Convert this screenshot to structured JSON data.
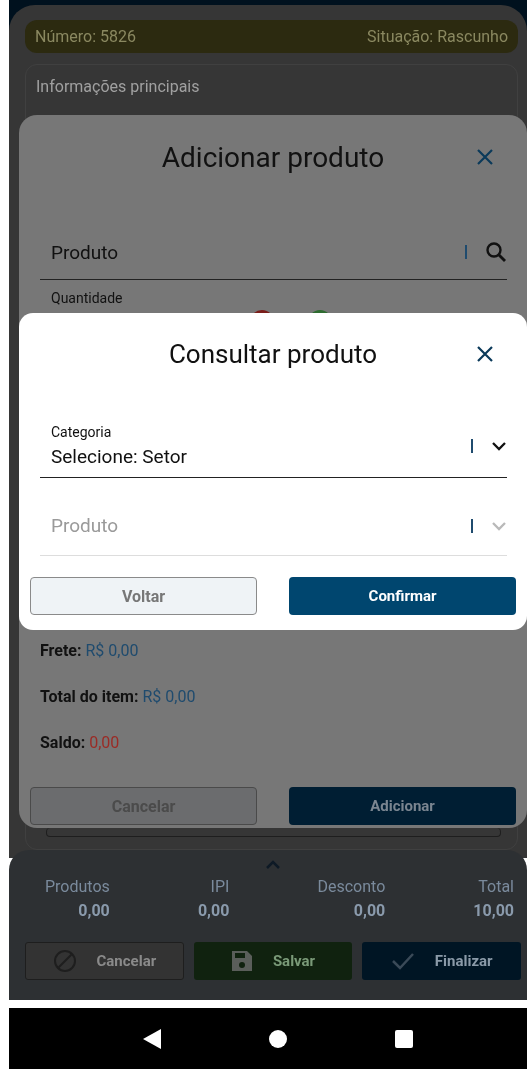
{
  "header": {
    "number": "Número: 5826",
    "status": "Situação: Rascunho"
  },
  "card": {
    "title": "Informações principais"
  },
  "add_dialog": {
    "title": "Adicionar produto",
    "product_field": {
      "placeholder": "Produto"
    },
    "quantity_label": "Quantidade",
    "lines": [
      {
        "label": "Frete:",
        "value": "R$ 0,00",
        "color": "#1f4b6e"
      },
      {
        "label": "Total do item:",
        "value": "R$ 0,00",
        "color": "#1f4b6e"
      },
      {
        "label": "Saldo:",
        "value": "0,00",
        "color": "#9b2b25"
      }
    ],
    "buttons": [
      {
        "label": "Cancelar",
        "kind": "secondary"
      },
      {
        "label": "Adicionar",
        "kind": "primary"
      }
    ]
  },
  "search_dialog": {
    "title": "Consultar produto",
    "fields": [
      {
        "label": "Categoria",
        "value": "Selecione: Setor",
        "disabled": false
      },
      {
        "placeholder": "Produto",
        "disabled": true
      }
    ],
    "buttons": [
      {
        "label": "Voltar",
        "kind": "secondary"
      },
      {
        "label": "Confirmar",
        "kind": "primary"
      }
    ]
  },
  "totals": [
    {
      "label": "Produtos",
      "value": "0,00"
    },
    {
      "label": "IPI",
      "value": "0,00"
    },
    {
      "label": "Desconto",
      "value": "0,00"
    },
    {
      "label": "Total",
      "value": "10,00"
    }
  ],
  "actions": [
    {
      "label": "Cancelar",
      "kind": "cancel"
    },
    {
      "label": "Salvar",
      "kind": "save"
    },
    {
      "label": "Finalizar",
      "kind": "finish"
    }
  ]
}
